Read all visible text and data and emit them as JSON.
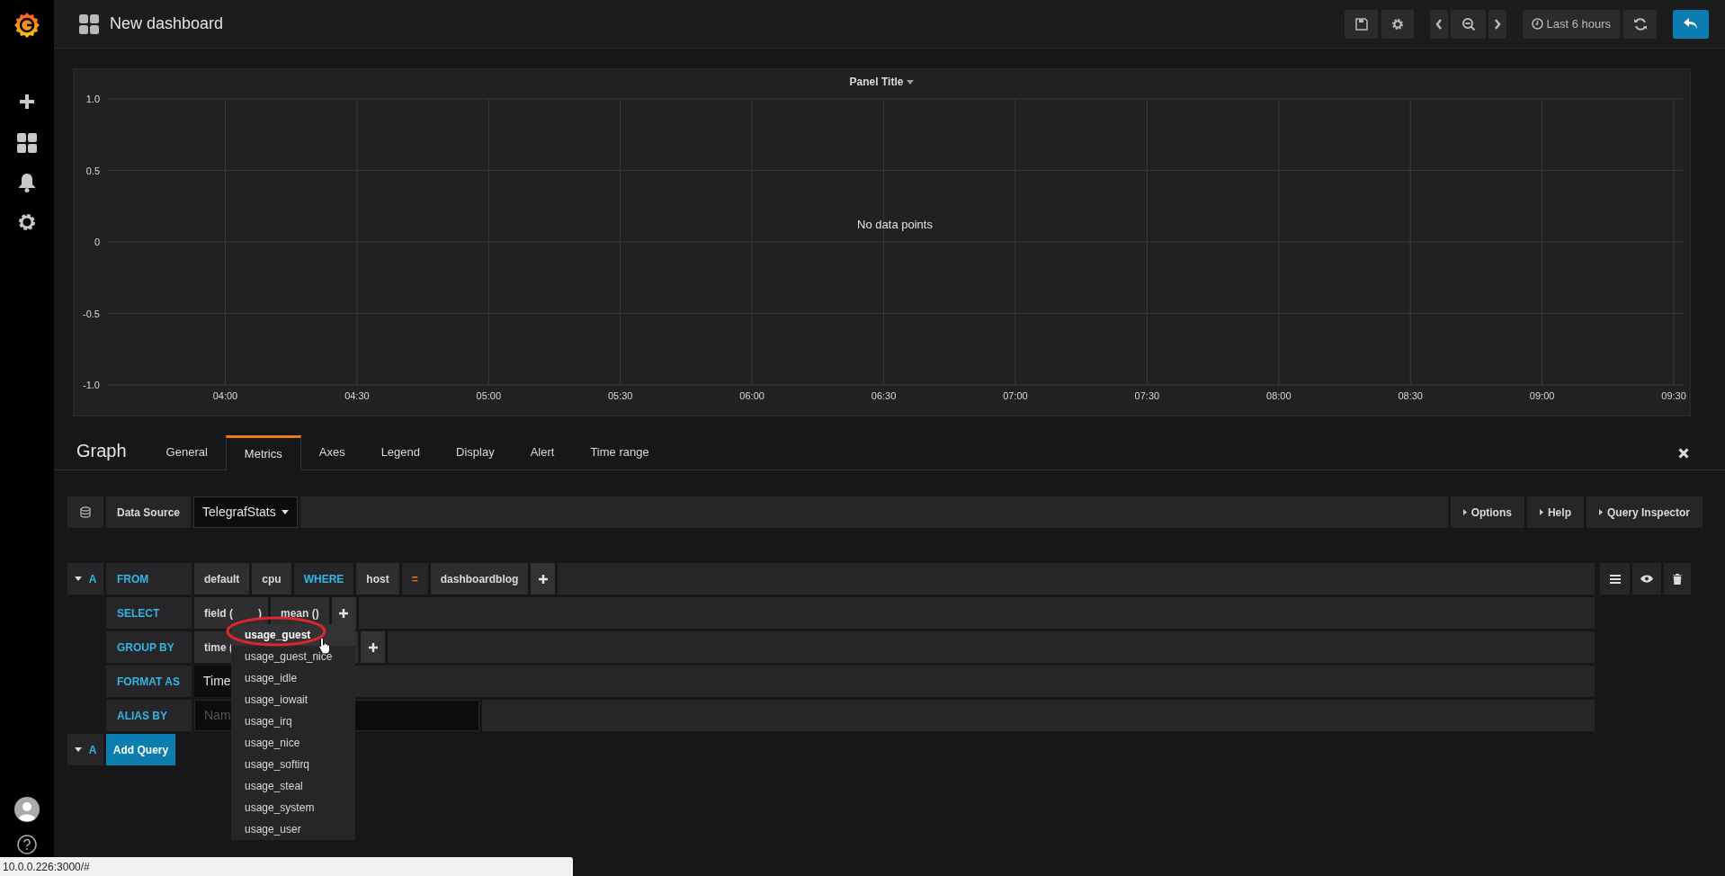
{
  "topbar": {
    "title": "New dashboard",
    "time_range": "Last 6 hours"
  },
  "panel": {
    "title": "Panel Title",
    "empty_message": "No data points",
    "chart_data": {
      "type": "line",
      "grid": true,
      "ylim": [
        -1,
        1
      ],
      "xlim": [
        3.551,
        9.534
      ],
      "yticks": [
        {
          "value": 1,
          "label": "1.0"
        },
        {
          "value": 0.5,
          "label": "0.5"
        },
        {
          "value": 0,
          "label": "0"
        },
        {
          "value": -0.5,
          "label": "-0.5"
        },
        {
          "value": -1,
          "label": "-1.0"
        }
      ],
      "xticks": [
        {
          "value": 4,
          "label": "04:00"
        },
        {
          "value": 4.5,
          "label": "04:30"
        },
        {
          "value": 5,
          "label": "05:00"
        },
        {
          "value": 5.5,
          "label": "05:30"
        },
        {
          "value": 6,
          "label": "06:00"
        },
        {
          "value": 6.5,
          "label": "06:30"
        },
        {
          "value": 7,
          "label": "07:00"
        },
        {
          "value": 7.5,
          "label": "07:30"
        },
        {
          "value": 8,
          "label": "08:00"
        },
        {
          "value": 8.5,
          "label": "08:30"
        },
        {
          "value": 9,
          "label": "09:00"
        },
        {
          "value": 9.5,
          "label": "09:30"
        }
      ]
    }
  },
  "editor": {
    "title": "Graph",
    "tabs": [
      {
        "label": "General",
        "selected": false
      },
      {
        "label": "Metrics",
        "selected": true
      },
      {
        "label": "Axes",
        "selected": false
      },
      {
        "label": "Legend",
        "selected": false
      },
      {
        "label": "Display",
        "selected": false
      },
      {
        "label": "Alert",
        "selected": false
      },
      {
        "label": "Time range",
        "selected": false
      }
    ]
  },
  "datasource": {
    "label": "Data Source",
    "value": "TelegrafStats",
    "buttons": [
      "Options",
      "Help",
      "Query Inspector"
    ]
  },
  "query": {
    "ref": "A",
    "rows": [
      {
        "label": "FROM",
        "segments": [
          {
            "kind": "value",
            "text": "default"
          },
          {
            "kind": "value",
            "text": "cpu"
          },
          {
            "kind": "keyword",
            "text": "WHERE"
          },
          {
            "kind": "value",
            "text": "host"
          },
          {
            "kind": "operator",
            "text": "="
          },
          {
            "kind": "value",
            "text": "dashboardblog"
          },
          {
            "kind": "add"
          }
        ]
      },
      {
        "label": "SELECT",
        "segments": [
          {
            "kind": "func",
            "text": "field (",
            "close": ")"
          },
          {
            "kind": "value",
            "text": "mean ()"
          },
          {
            "kind": "add"
          }
        ]
      },
      {
        "label": "GROUP BY",
        "segments": [
          {
            "kind": "cut",
            "text": "time ("
          },
          {
            "kind": "add"
          }
        ]
      },
      {
        "label": "FORMAT AS",
        "segments": [
          {
            "kind": "select",
            "text": "Time"
          }
        ]
      },
      {
        "label": "ALIAS BY",
        "segments": [
          {
            "kind": "input",
            "placeholder": "Nam"
          }
        ]
      }
    ]
  },
  "add_query": {
    "ref": "A",
    "button": "Add Query"
  },
  "dropdown": {
    "items": [
      {
        "label": "usage_guest",
        "selected": true
      },
      {
        "label": "usage_guest_nice",
        "selected": false
      },
      {
        "label": "usage_idle",
        "selected": false
      },
      {
        "label": "usage_iowait",
        "selected": false
      },
      {
        "label": "usage_irq",
        "selected": false
      },
      {
        "label": "usage_nice",
        "selected": false
      },
      {
        "label": "usage_softirq",
        "selected": false
      },
      {
        "label": "usage_steal",
        "selected": false
      },
      {
        "label": "usage_system",
        "selected": false
      },
      {
        "label": "usage_user",
        "selected": false
      }
    ]
  },
  "status_bar": "10.0.0.226:3000/#"
}
